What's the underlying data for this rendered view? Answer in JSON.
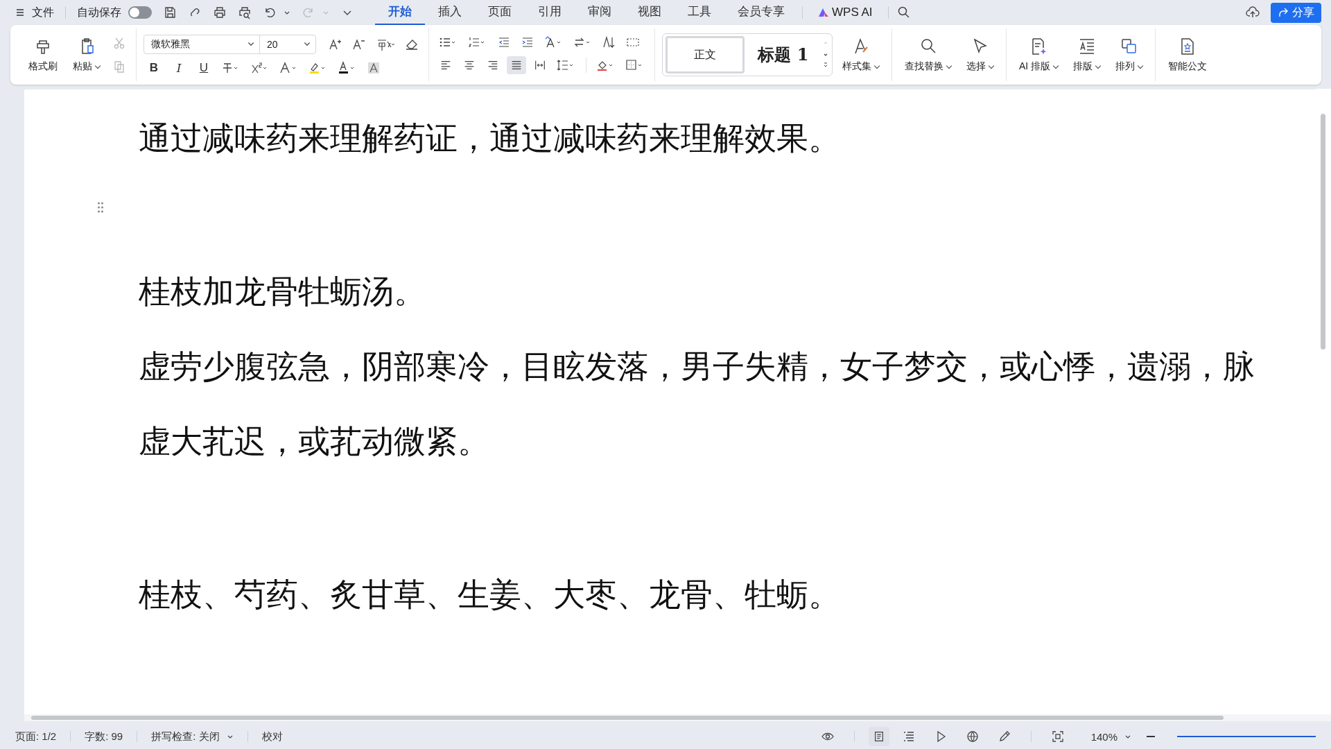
{
  "menu": {
    "file": "文件",
    "autosave": {
      "label": "自动保存",
      "on": false
    }
  },
  "tabs": [
    {
      "label": "开始",
      "selected": true
    },
    {
      "label": "插入",
      "selected": false
    },
    {
      "label": "页面",
      "selected": false
    },
    {
      "label": "引用",
      "selected": false
    },
    {
      "label": "审阅",
      "selected": false
    },
    {
      "label": "视图",
      "selected": false
    },
    {
      "label": "工具",
      "selected": false
    },
    {
      "label": "会员专享",
      "selected": false
    }
  ],
  "ai_tab": "WPS AI",
  "share": "分享",
  "ribbon": {
    "format_painter": "格式刷",
    "paste": "粘贴",
    "font": "微软雅黑",
    "size": "20",
    "format_glyphs": [
      "B",
      "I",
      "U"
    ],
    "align_buttons": [
      {
        "selected": false
      },
      {
        "selected": false
      },
      {
        "selected": false
      },
      {
        "selected": true
      },
      {
        "selected": false
      }
    ],
    "styles": [
      {
        "label": "正文",
        "selected": true
      },
      {
        "label": "标题 1",
        "selected": false
      }
    ],
    "style_set": "样式集",
    "tools": [
      {
        "label": "查找替换",
        "kind": "search"
      },
      {
        "label": "选择",
        "kind": "select"
      }
    ],
    "layout_tools": [
      {
        "label": "AI 排版",
        "kind": "ai"
      },
      {
        "label": "排版",
        "kind": "layout"
      },
      {
        "label": "排列",
        "kind": "arrange"
      }
    ],
    "official_doc": "智能公文"
  },
  "document": [
    {
      "kind": "text",
      "text": "通过减味药来理解药证，通过减味药来理解效果。"
    },
    {
      "kind": "blank"
    },
    {
      "kind": "text",
      "text": "桂枝加龙骨牡蛎汤。"
    },
    {
      "kind": "text",
      "text": "虚劳少腹弦急，阴部寒冷，目眩发落，男子失精，女子梦交，或心悸，遗溺，脉虚大芤迟，或芤动微紧。"
    },
    {
      "kind": "blank"
    },
    {
      "kind": "text",
      "text": "桂枝、芍药、炙甘草、生姜、大枣、龙骨、牡蛎。"
    }
  ],
  "status_bar": {
    "page": "页面: 1/2",
    "words": "字数: 99",
    "spell": "拼写检查: 关闭",
    "proof": "校对",
    "zoom": "140%"
  }
}
